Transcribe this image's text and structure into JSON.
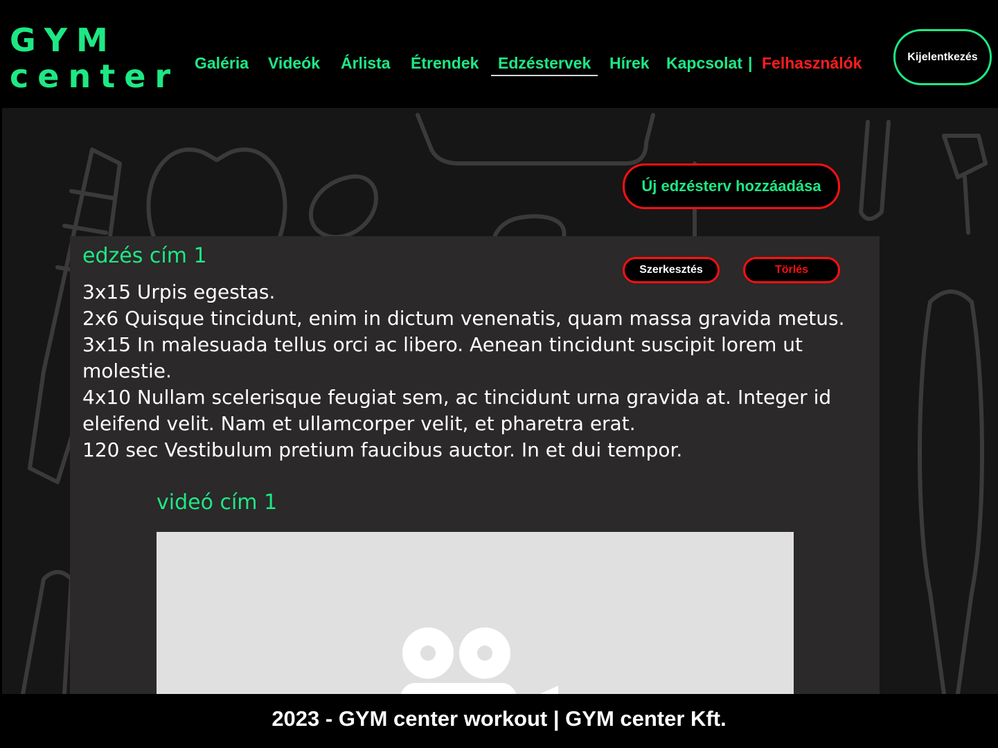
{
  "logo": {
    "line1": "GYM",
    "line2": "center"
  },
  "nav": {
    "items": [
      {
        "label": "Galéria"
      },
      {
        "label": "Videók"
      },
      {
        "label": "Árlista"
      },
      {
        "label": "Étrendek"
      },
      {
        "label": "Edzéstervek",
        "active": true
      },
      {
        "label": "Hírek"
      },
      {
        "label": "Kapcsolat"
      }
    ],
    "separator": "|",
    "users_label": "Felhasználók"
  },
  "header": {
    "logout_label": "Kijelentkezés"
  },
  "toolbar": {
    "add_label": "Új edzésterv hozzáadása"
  },
  "workout": {
    "title": "edzés cím 1",
    "edit_label": "Szerkesztés",
    "delete_label": "Törlés",
    "lines": [
      "3x15 Urpis egestas.",
      "2x6 Quisque tincidunt, enim in dictum venenatis, quam massa gravida metus.",
      "3x15 In malesuada tellus orci ac libero. Aenean tincidunt suscipit lorem ut molestie.",
      "4x10 Nullam scelerisque feugiat sem, ac tincidunt urna gravida at. Integer id eleifend velit. Nam et ullamcorper velit, et pharetra erat.",
      "120 sec Vestibulum pretium faucibus auctor. In et dui tempor."
    ],
    "video_title": "videó cím 1"
  },
  "footer": {
    "text": "2023 - GYM center workout | GYM center Kft."
  },
  "colors": {
    "accent": "#1ee884",
    "danger": "#ff1010",
    "card_bg": "#2b2929",
    "page_bg": "#000000"
  }
}
